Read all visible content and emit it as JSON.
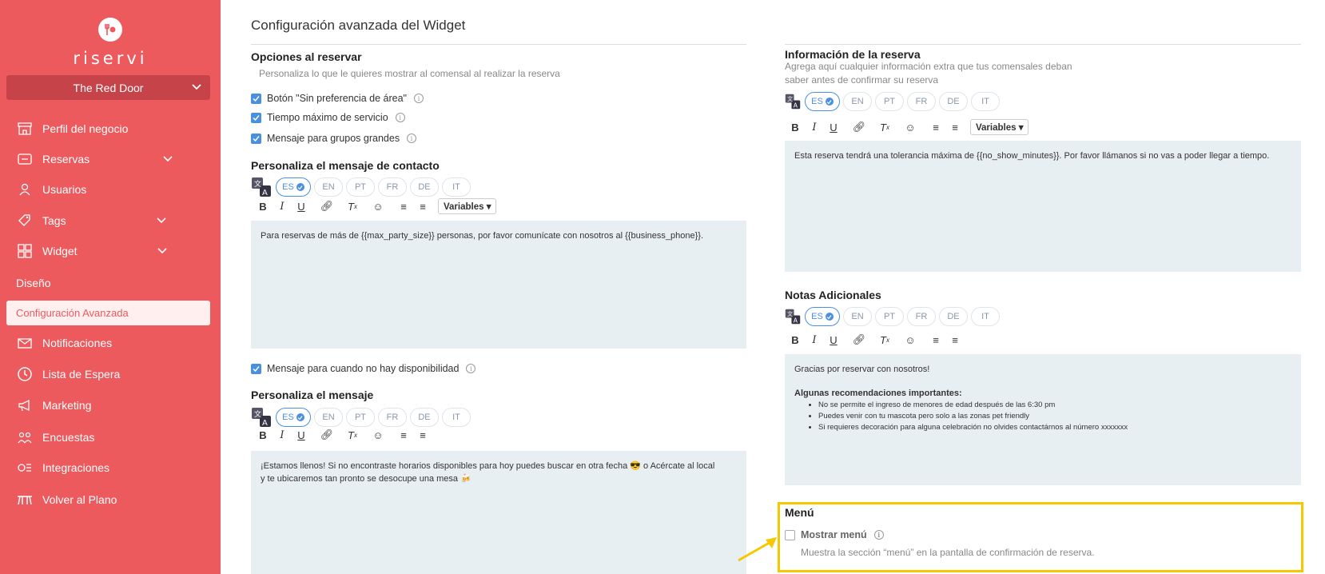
{
  "app": {
    "logo_text": "riservi",
    "venue": "The Red Door"
  },
  "sidebar": {
    "items": [
      {
        "label": "Perfil del negocio",
        "icon": "store-icon"
      },
      {
        "label": "Reservas",
        "icon": "tablet-icon"
      },
      {
        "label": "Usuarios",
        "icon": "user-icon"
      },
      {
        "label": "Tags",
        "icon": "tag-icon"
      },
      {
        "label": "Widget",
        "icon": "grid-icon"
      },
      {
        "label": "Notificaciones",
        "icon": "envelope-icon"
      },
      {
        "label": "Lista de Espera",
        "icon": "clock-icon"
      },
      {
        "label": "Marketing",
        "icon": "megaphone-icon"
      },
      {
        "label": "Encuestas",
        "icon": "people-icon"
      },
      {
        "label": "Integraciones",
        "icon": "integrations-icon"
      },
      {
        "label": "Volver al Plano",
        "icon": "table-icon"
      }
    ],
    "sub_diseno": "Diseño",
    "sub_active": "Configuración Avanzada"
  },
  "main": {
    "page_title": "Configuración avanzada del Widget",
    "opciones": {
      "title": "Opciones al reservar",
      "desc": "Personaliza lo que le quieres mostrar al comensal al realizar la reserva",
      "checks": [
        "Botón \"Sin preferencia de área\"",
        "Tiempo máximo de servicio",
        "Mensaje para grupos grandes"
      ]
    },
    "contacto": {
      "title": "Personaliza el mensaje de contacto",
      "text": "Para reservas de más de {{max_party_size}} personas, por favor comunícate con nosotros al {{business_phone}}."
    },
    "no_disp_check": "Mensaje para cuando no hay disponibilidad",
    "mensaje": {
      "title": "Personaliza el mensaje",
      "text_line1": "¡Estamos llenos! Si no encontraste horarios disponibles para hoy puedes buscar en otra fecha 😎 o Acércate al local",
      "text_line2": "y te ubicaremos tan pronto se desocupe una mesa 🍻"
    },
    "info_reserva": {
      "title": "Información de la reserva",
      "desc_line1": "Agrega aquí cualquier información extra que tus comensales deban",
      "desc_line2": "saber antes de confirmar su reserva",
      "text": "Esta reserva tendrá una tolerancia máxima de {{no_show_minutes}}. Por favor llámanos si no vas a poder llegar a tiempo."
    },
    "notas": {
      "title": "Notas Adicionales",
      "line1": "Gracias por reservar con nosotros!",
      "heading": "Algunas recomendaciones importantes:",
      "bullets": [
        "No se permite el ingreso de menores de edad después de las 6:30 pm",
        "Puedes venir con tu mascota pero solo a las zonas pet friendly",
        "Si requieres decoración para alguna celebración no olvides contactárnos al número xxxxxxx"
      ]
    },
    "menu": {
      "title": "Menú",
      "check": "Mostrar menú",
      "desc": "Muestra la sección “menú” en la pantalla de confirmación de reserva."
    },
    "languages": [
      "ES",
      "EN",
      "PT",
      "FR",
      "DE",
      "IT"
    ],
    "variables_label": "Variables"
  },
  "colors": {
    "sidebar": "#ec5a5e",
    "accent": "#4a8fe0",
    "highlight": "#f5c800"
  }
}
